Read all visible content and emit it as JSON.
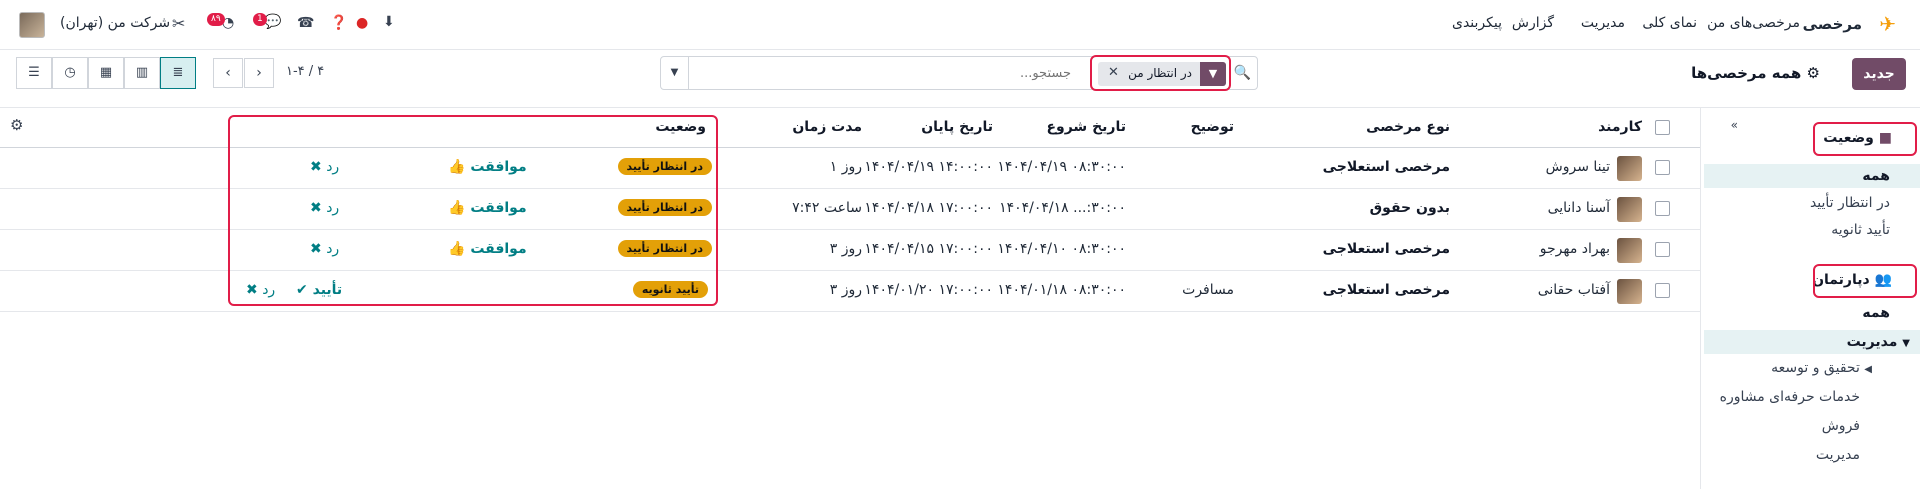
{
  "navbar": {
    "app_name": "مرخصی",
    "menu": [
      "مرخصی‌های من",
      "نمای کلی",
      "مدیریت",
      "گزارش",
      "پیکربندی"
    ],
    "company": "شرکت من (تهران)",
    "activity_badge": "۸۹",
    "chat_badge": "1"
  },
  "control": {
    "new_label": "جدید",
    "title": "همه مرخصی‌ها",
    "search_placeholder": "جستجو...",
    "facet_label": "در انتظار من",
    "pager": "۱-۴ / ۴"
  },
  "sidebar": {
    "status_title": "وضعیت",
    "status_items": [
      "همه",
      "در انتظار تأیید",
      "تأیید ثانویه"
    ],
    "dept_title": "دپارتمان",
    "dept_all": "همه",
    "dept_parent": "مدیریت",
    "dept_children": [
      "تحقیق و توسعه",
      "خدمات حرفه‌ای مشاوره",
      "فروش",
      "مدیریت"
    ]
  },
  "table": {
    "headers": {
      "employee": "کارمند",
      "type": "نوع مرخصی",
      "description": "توضیح",
      "start": "تاریخ شروع",
      "end": "تاریخ پایان",
      "duration": "مدت زمان",
      "status": "وضعیت"
    },
    "rows": [
      {
        "employee": "تینا سروش",
        "type": "مرخصی استعلاجی",
        "description": "",
        "start": "۱۴۰۴/۰۴/۱۹ ۰۸:۳۰:۰۰",
        "end": "۱۴۰۴/۰۴/۱۹ ۱۴:۰۰:۰۰",
        "duration": "۱ روز",
        "status": "در انتظار تأیید",
        "approve": "موافقت",
        "refuse": "رد"
      },
      {
        "employee": "آسنا دانایی",
        "type": "بدون حقوق",
        "description": "",
        "start": "۱۴۰۴/۰۴/۱۸ ...:۳۰:۰۰",
        "end": "۱۴۰۴/۰۴/۱۸ ۱۷:۰۰:۰۰",
        "duration": "۷:۴۲ ساعت",
        "status": "در انتظار تأیید",
        "approve": "موافقت",
        "refuse": "رد"
      },
      {
        "employee": "بهراد مهرجو",
        "type": "مرخصی استعلاجی",
        "description": "",
        "start": "۱۴۰۴/۰۴/۱۰ ۰۸:۳۰:۰۰",
        "end": "۱۴۰۴/۰۴/۱۵ ۱۷:۰۰:۰۰",
        "duration": "۳ روز",
        "status": "در انتظار تأیید",
        "approve": "موافقت",
        "refuse": "رد"
      },
      {
        "employee": "آفتاب حقانی",
        "type": "مرخصی استعلاجی",
        "description": "مسافرت",
        "start": "۱۴۰۴/۰۱/۱۸ ۰۸:۳۰:۰۰",
        "end": "۱۴۰۴/۰۱/۲۰ ۱۷:۰۰:۰۰",
        "duration": "۳ روز",
        "status": "تأیید ثانویه",
        "approve": "تأیید",
        "refuse": "رد"
      }
    ]
  },
  "colors": {
    "brand": "#714b67",
    "teal": "#017e84",
    "pill": "#e3a008",
    "highlight": "#e11d48"
  }
}
